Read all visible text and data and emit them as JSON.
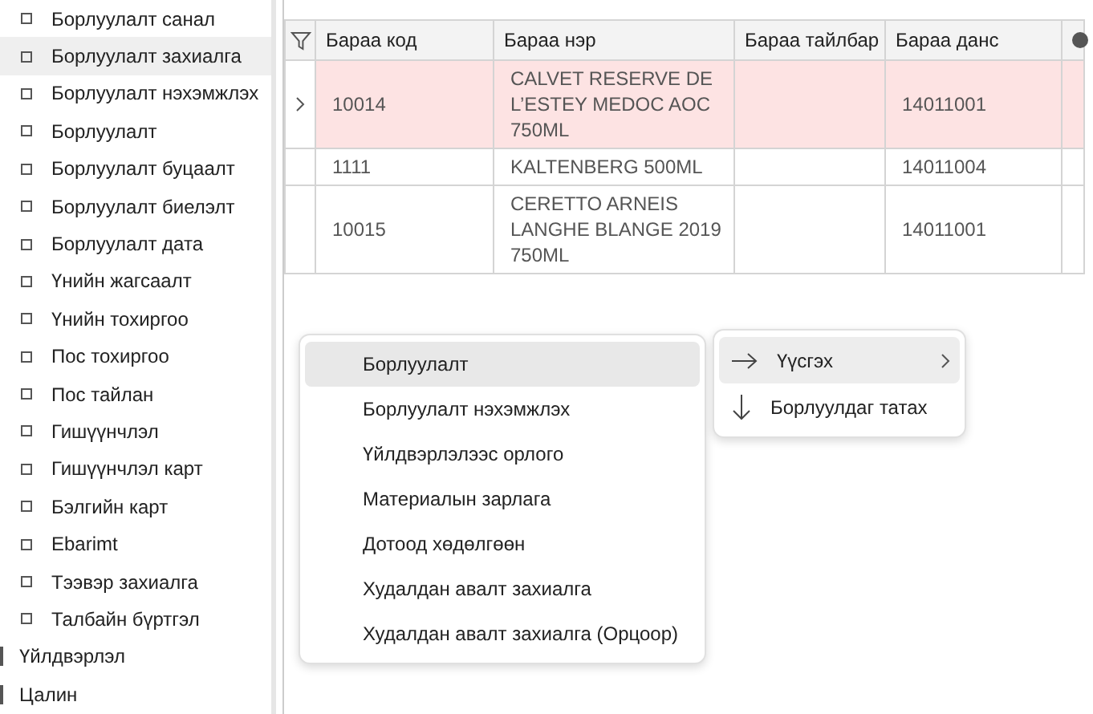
{
  "sidebar": {
    "items": [
      {
        "label": "Борлуулалт санал",
        "selected": false
      },
      {
        "label": "Борлуулалт захиалга",
        "selected": true
      },
      {
        "label": "Борлуулалт нэхэмжлэх",
        "selected": false
      },
      {
        "label": "Борлуулалт",
        "selected": false
      },
      {
        "label": "Борлуулалт буцаалт",
        "selected": false
      },
      {
        "label": "Борлуулалт биелэлт",
        "selected": false
      },
      {
        "label": "Борлуулалт дата",
        "selected": false
      },
      {
        "label": "Үнийн жагсаалт",
        "selected": false
      },
      {
        "label": "Үнийн тохиргоо",
        "selected": false
      },
      {
        "label": "Пос тохиргоо",
        "selected": false
      },
      {
        "label": "Пос тайлан",
        "selected": false
      },
      {
        "label": "Гишүүнчлэл",
        "selected": false
      },
      {
        "label": "Гишүүнчлэл карт",
        "selected": false
      },
      {
        "label": "Бэлгийн карт",
        "selected": false
      },
      {
        "label": "Ebarimt",
        "selected": false
      },
      {
        "label": "Тээвэр захиалга",
        "selected": false
      },
      {
        "label": "Талбайн бүртгэл",
        "selected": false
      }
    ],
    "modules": [
      {
        "label": "Үйлдвэрлэл"
      },
      {
        "label": "Цалин"
      }
    ]
  },
  "grid": {
    "columns": [
      "Бараа код",
      "Бараа нэр",
      "Бараа тайлбар",
      "Бараа данс"
    ],
    "rows": [
      {
        "code": "10014",
        "name": "CALVET RESERVE DE L’ESTEY MEDOC AOC 750ML",
        "account": "14011001",
        "selected": true
      },
      {
        "code": "1111",
        "name": "KALTENBERG 500ML",
        "account": "14011004",
        "selected": false
      },
      {
        "code": "10015",
        "name": "CERETTO ARNEIS LANGHE BLANGE 2019 750ML",
        "account": "14011001",
        "selected": false
      }
    ]
  },
  "context_menu": {
    "items": [
      {
        "label": "Борлуулалт",
        "highlighted": true
      },
      {
        "label": "Борлуулалт нэхэмжлэх",
        "highlighted": false
      },
      {
        "label": "Үйлдвэрлэлээс орлого",
        "highlighted": false
      },
      {
        "label": "Материалын зарлага",
        "highlighted": false
      },
      {
        "label": "Дотоод хөдөлгөөн",
        "highlighted": false
      },
      {
        "label": "Худалдан авалт захиалга",
        "highlighted": false
      },
      {
        "label": "Худалдан авалт захиалга (Орцоор)",
        "highlighted": false
      }
    ]
  },
  "action_menu": {
    "items": [
      {
        "label": "Үүсгэх",
        "kind": "create",
        "highlighted": true,
        "has_submenu": true
      },
      {
        "label": "Борлуулдаг татах",
        "kind": "import",
        "highlighted": false,
        "has_submenu": false
      }
    ]
  }
}
